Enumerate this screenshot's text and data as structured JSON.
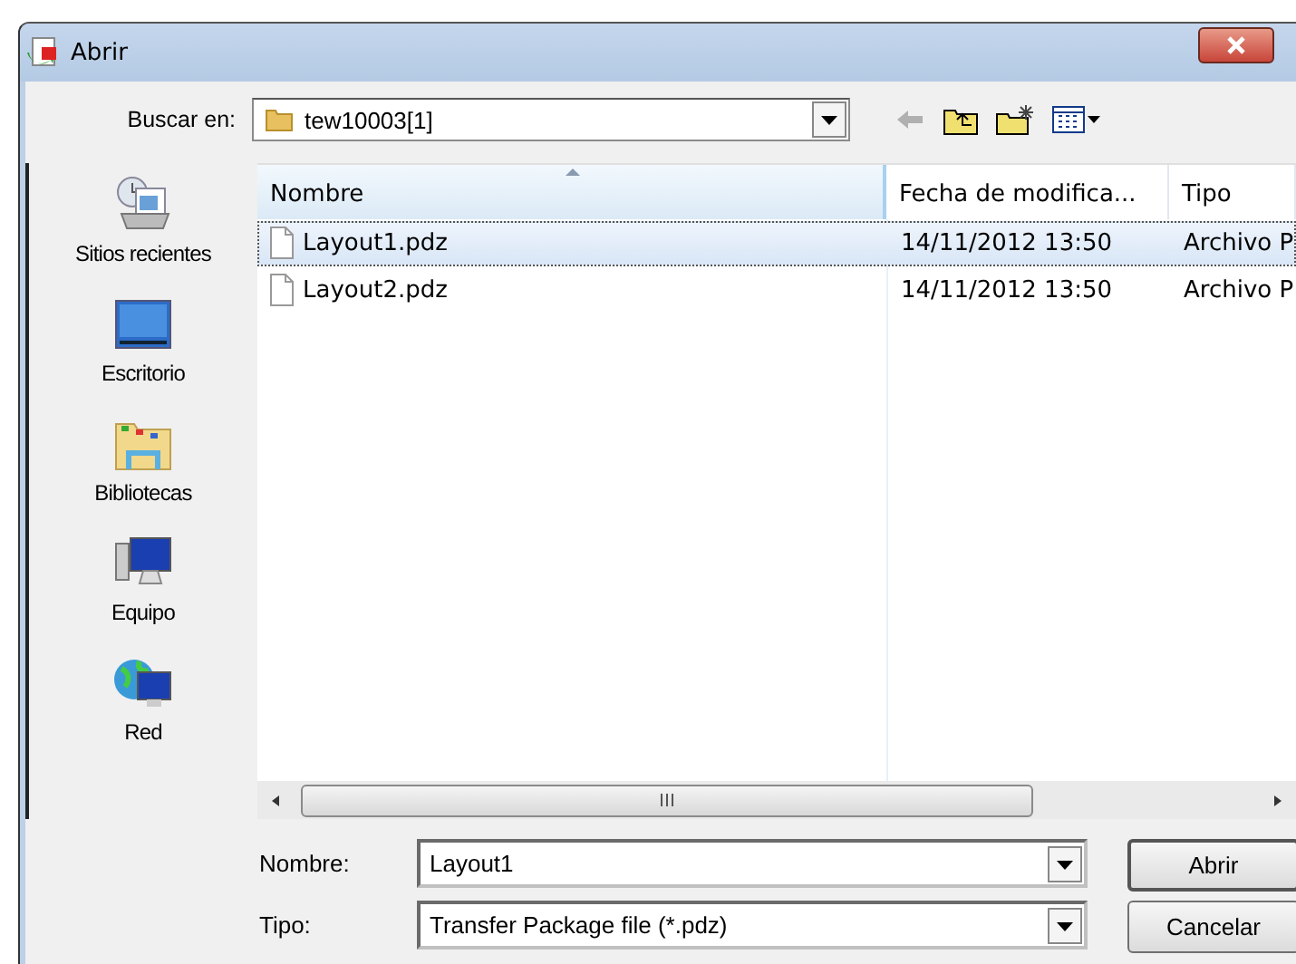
{
  "window": {
    "title": "Abrir"
  },
  "toolbar": {
    "label": "Buscar en:",
    "location": "tew10003[1]",
    "back_disabled": true
  },
  "places": [
    {
      "label": "Sitios recientes",
      "kind": "recent"
    },
    {
      "label": "Escritorio",
      "kind": "desktop"
    },
    {
      "label": "Bibliotecas",
      "kind": "libraries"
    },
    {
      "label": "Equipo",
      "kind": "computer"
    },
    {
      "label": "Red",
      "kind": "network"
    }
  ],
  "file_list": {
    "columns": [
      {
        "label": "Nombre",
        "sorted": true
      },
      {
        "label": "Fecha de modifica...",
        "sorted": false
      },
      {
        "label": "Tipo",
        "sorted": false
      }
    ],
    "rows": [
      {
        "name": "Layout1.pdz",
        "date": "14/11/2012 13:50",
        "type": "Archivo P",
        "selected": true
      },
      {
        "name": "Layout2.pdz",
        "date": "14/11/2012 13:50",
        "type": "Archivo P",
        "selected": false
      }
    ]
  },
  "fields": [
    {
      "label": "Nombre:",
      "value": "Layout1"
    },
    {
      "label": "Tipo:",
      "value": "Transfer Package file (*.pdz)"
    }
  ],
  "buttons": [
    "Abrir",
    "Cancelar"
  ]
}
